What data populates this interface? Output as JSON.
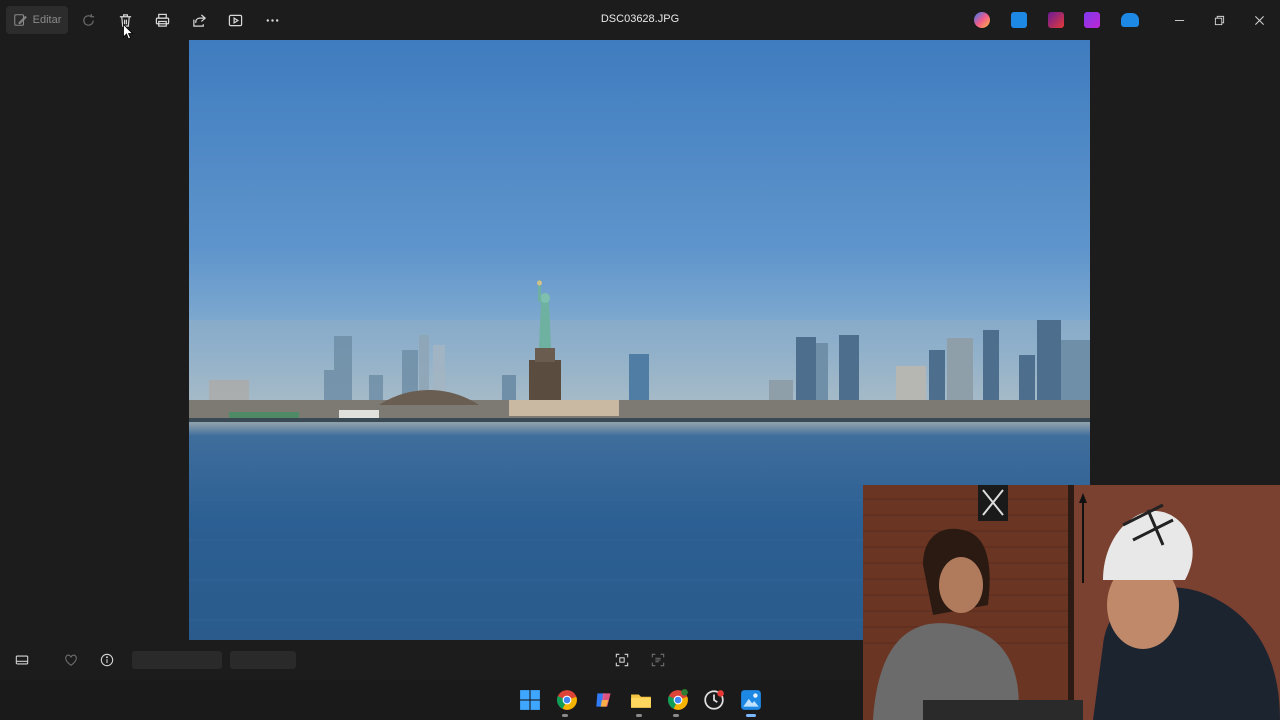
{
  "window": {
    "title": "DSC03628.JPG"
  },
  "toolbar": {
    "edit_label": "Editar",
    "items": [
      {
        "icon": "rotate-icon",
        "disabled": true
      },
      {
        "icon": "delete-icon"
      },
      {
        "icon": "print-icon"
      },
      {
        "icon": "share-icon"
      },
      {
        "icon": "slideshow-icon"
      },
      {
        "icon": "more-icon"
      }
    ]
  },
  "title_bar_apps": [
    "copilot-icon",
    "photos-editor-icon",
    "clipchamp-icon",
    "designer-icon",
    "onedrive-icon"
  ],
  "window_controls": [
    "minimize-icon",
    "restore-icon",
    "close-icon"
  ],
  "bottom_bar": {
    "left": [
      "filmstrip-icon",
      "favorite-icon",
      "info-icon"
    ],
    "center": [
      "fit-to-window-icon",
      "visual-search-icon"
    ]
  },
  "taskbar": {
    "apps": [
      "start-icon",
      "chrome-icon",
      "copilot-icon",
      "file-explorer-icon",
      "chrome-profile-icon",
      "clock-app-icon",
      "photos-icon"
    ],
    "active": "photos-icon"
  },
  "colors": {
    "background": "#1c1c1c",
    "accent": "#7ab7ff"
  }
}
